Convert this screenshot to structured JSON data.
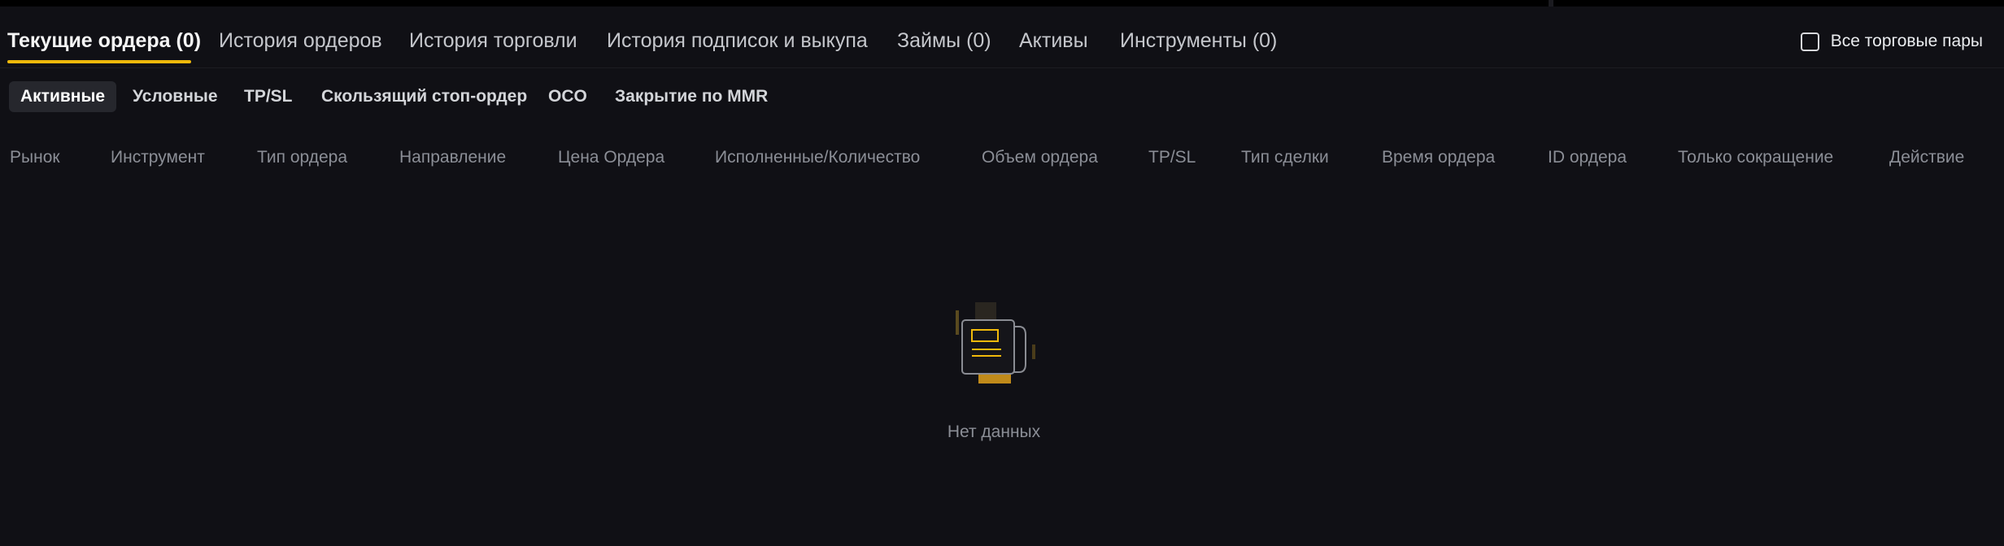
{
  "main_tabs": [
    {
      "label": "Текущие ордера (0)",
      "active": true
    },
    {
      "label": "История ордеров"
    },
    {
      "label": "История торговли"
    },
    {
      "label": "История подписок и выкупа"
    },
    {
      "label": "Займы (0)"
    },
    {
      "label": "Активы"
    },
    {
      "label": "Инструменты (0)"
    }
  ],
  "all_pairs_label": "Все торговые пары",
  "sub_tabs": [
    {
      "label": "Активные",
      "active": true
    },
    {
      "label": "Условные"
    },
    {
      "label": "TP/SL"
    },
    {
      "label": "Скользящий стоп-ордер"
    },
    {
      "label": "OCO"
    },
    {
      "label": "Закрытие по MMR"
    }
  ],
  "columns": [
    "Рынок",
    "Инструмент",
    "Тип ордера",
    "Направление",
    "Цена Ордера",
    "Исполненные/Количество",
    "Объем ордера",
    "TP/SL",
    "Тип сделки",
    "Время ордера",
    "ID ордера",
    "Только сокращение",
    "Действие"
  ],
  "empty_state": {
    "text": "Нет данных",
    "icon": "no-data-icon"
  },
  "colors": {
    "accent": "#f0b90b",
    "background": "#101015",
    "muted": "#8b8e96"
  }
}
